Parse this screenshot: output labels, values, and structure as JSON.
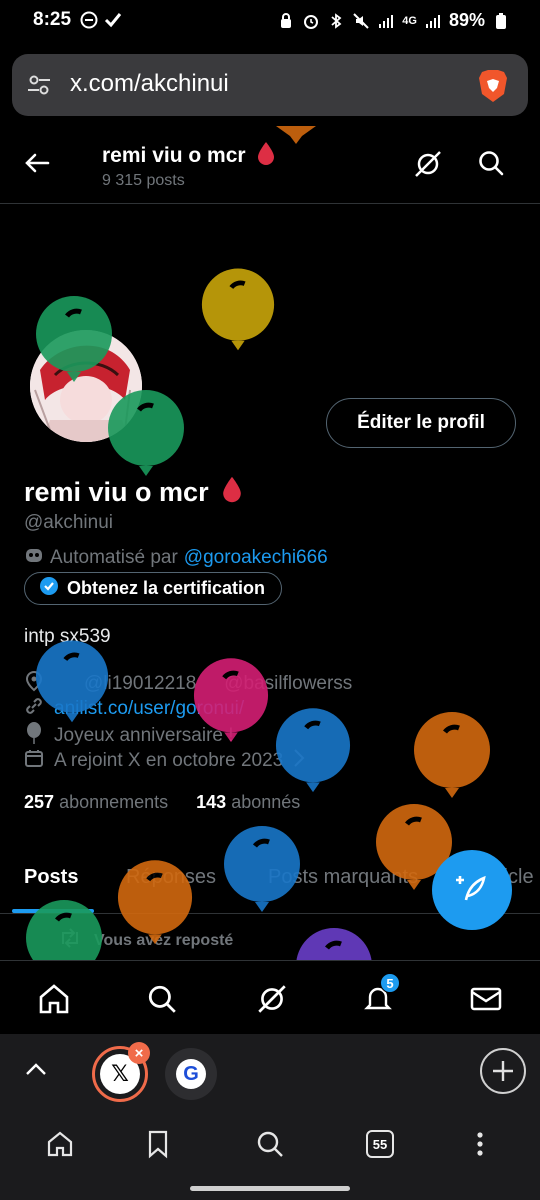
{
  "status_bar": {
    "time": "8:25",
    "battery": "89%",
    "network": "4G"
  },
  "browser": {
    "url": "x.com/akchinui",
    "tabs_count": "55"
  },
  "header": {
    "title": "remi viu o mcr",
    "post_count": "9 315 posts"
  },
  "profile": {
    "display_name": "remi viu o mcr",
    "handle": "@akchinui",
    "automated_prefix": "Automatisé par",
    "automated_by": "@goroakechi666",
    "edit_label": "Éditer le profil",
    "cert_label": "Obtenez la certification",
    "bio": "intp sx539",
    "location_a": "@li19012218",
    "location_b": "@basilflowerss",
    "link": "anilist.co/user/goronui/",
    "birthday": "Joyeux anniversaire !",
    "joined": "A rejoint X en octobre 2023",
    "following_count": "257",
    "following_label": "abonnements",
    "followers_count": "143",
    "followers_label": "abonnés"
  },
  "tabs": [
    "Posts",
    "Réponses",
    "Posts marquants",
    "Article"
  ],
  "active_tab": "Posts",
  "reposted_label": "Vous avez reposté",
  "notifications_badge": "5",
  "colors": {
    "accent": "#1d9bf0",
    "balloon_green": "#1a9a5c",
    "balloon_yellow": "#c9a60a",
    "balloon_orange": "#d2690f",
    "balloon_pink": "#d41f74",
    "balloon_blue": "#1977c9",
    "balloon_purple": "#6a3fc9"
  }
}
